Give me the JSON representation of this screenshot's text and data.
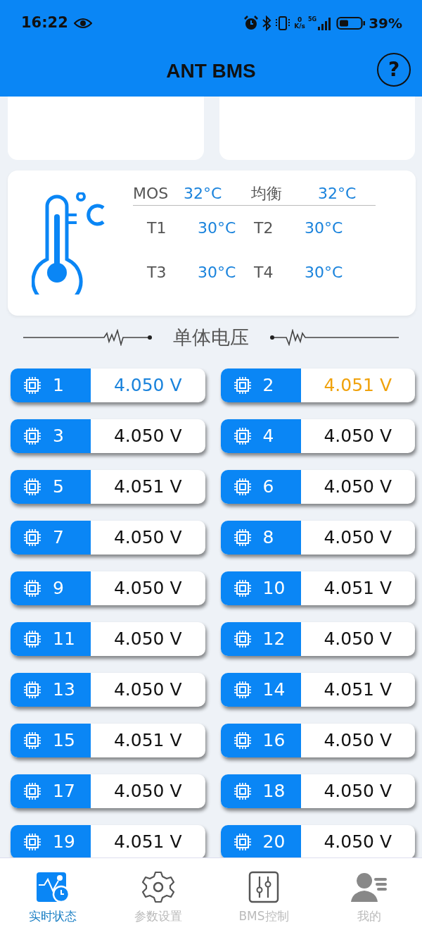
{
  "status_bar": {
    "time": "16:22",
    "network_speed_value": "0",
    "network_speed_unit": "K/s",
    "network_type": "5G",
    "battery": "39%"
  },
  "app_bar": {
    "title": "ANT BMS",
    "help": "?"
  },
  "temperature": {
    "mos_label": "MOS",
    "mos_value": "32°C",
    "balance_label": "均衡",
    "balance_value": "32°C",
    "sensors": [
      {
        "label": "T1",
        "value": "30°C"
      },
      {
        "label": "T2",
        "value": "30°C"
      },
      {
        "label": "T3",
        "value": "30°C"
      },
      {
        "label": "T4",
        "value": "30°C"
      }
    ]
  },
  "section_title": "单体电压",
  "cells": [
    {
      "number": "1",
      "voltage": "4.050 V",
      "color": "#1a83dc"
    },
    {
      "number": "2",
      "voltage": "4.051 V",
      "color": "#f0a20c"
    },
    {
      "number": "3",
      "voltage": "4.050 V",
      "color": "#111111"
    },
    {
      "number": "4",
      "voltage": "4.050 V",
      "color": "#111111"
    },
    {
      "number": "5",
      "voltage": "4.051 V",
      "color": "#111111"
    },
    {
      "number": "6",
      "voltage": "4.050 V",
      "color": "#111111"
    },
    {
      "number": "7",
      "voltage": "4.050 V",
      "color": "#111111"
    },
    {
      "number": "8",
      "voltage": "4.050 V",
      "color": "#111111"
    },
    {
      "number": "9",
      "voltage": "4.050 V",
      "color": "#111111"
    },
    {
      "number": "10",
      "voltage": "4.051 V",
      "color": "#111111"
    },
    {
      "number": "11",
      "voltage": "4.050 V",
      "color": "#111111"
    },
    {
      "number": "12",
      "voltage": "4.050 V",
      "color": "#111111"
    },
    {
      "number": "13",
      "voltage": "4.050 V",
      "color": "#111111"
    },
    {
      "number": "14",
      "voltage": "4.051 V",
      "color": "#111111"
    },
    {
      "number": "15",
      "voltage": "4.051 V",
      "color": "#111111"
    },
    {
      "number": "16",
      "voltage": "4.050 V",
      "color": "#111111"
    },
    {
      "number": "17",
      "voltage": "4.050 V",
      "color": "#111111"
    },
    {
      "number": "18",
      "voltage": "4.050 V",
      "color": "#111111"
    },
    {
      "number": "19",
      "voltage": "4.051 V",
      "color": "#111111"
    },
    {
      "number": "20",
      "voltage": "4.050 V",
      "color": "#111111"
    }
  ],
  "bottom_nav": [
    {
      "label": "实时状态",
      "kind": "realtime",
      "selected": true
    },
    {
      "label": "参数设置",
      "kind": "settings",
      "selected": false
    },
    {
      "label": "BMS控制",
      "kind": "control",
      "selected": false
    },
    {
      "label": "我的",
      "kind": "profile",
      "selected": false
    }
  ]
}
